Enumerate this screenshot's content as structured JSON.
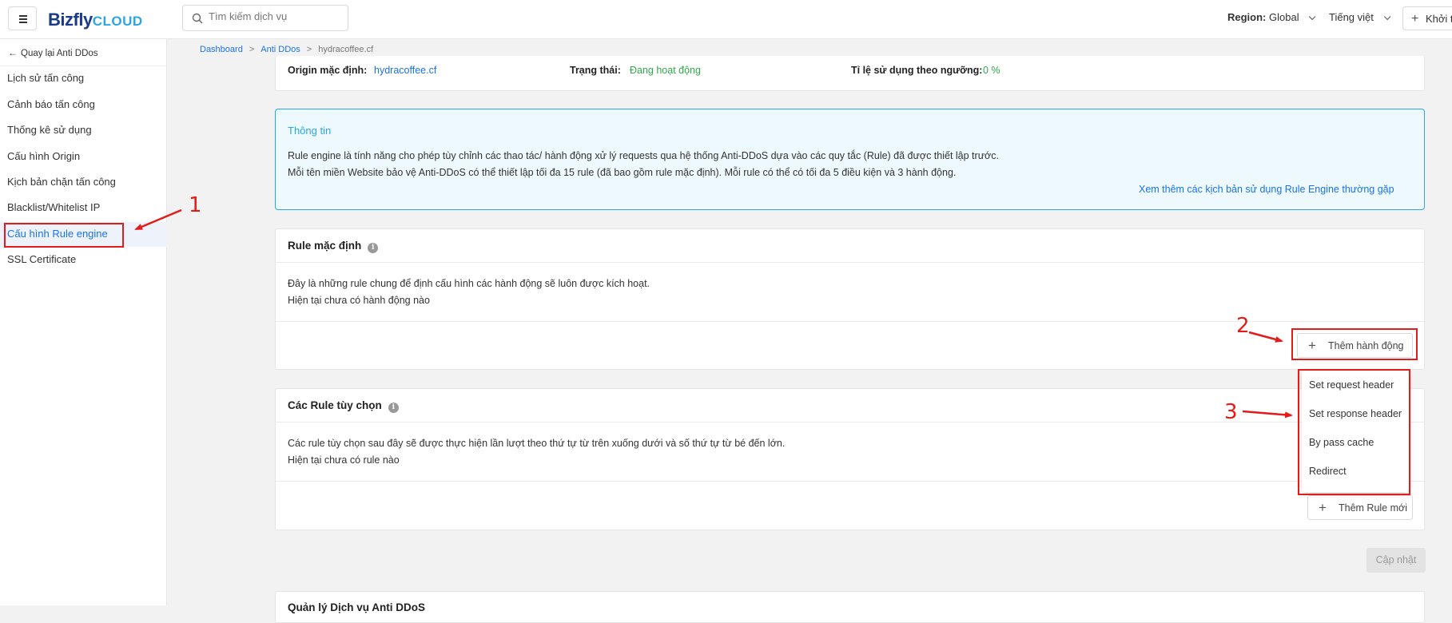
{
  "topbar": {
    "logo_main": "Bizfly",
    "logo_cloud": "CLOUD",
    "search_placeholder": "Tìm kiếm dịch vụ",
    "region_label": "Region:",
    "region_value": "Global",
    "language": "Tiếng việt",
    "init_button": "Khởi tạo"
  },
  "sidebar": {
    "back_label": "Quay lại Anti DDos",
    "items": [
      {
        "label": "Lịch sử tấn công"
      },
      {
        "label": "Cảnh báo tấn công"
      },
      {
        "label": "Thống kê sử dụng"
      },
      {
        "label": "Cấu hình Origin"
      },
      {
        "label": "Kịch bản chặn tấn công"
      },
      {
        "label": "Blacklist/Whitelist IP"
      },
      {
        "label": "Cấu hình Rule engine"
      },
      {
        "label": "SSL Certificate"
      }
    ],
    "active_item": "Cấu hình Rule engine"
  },
  "breadcrumb": {
    "items": [
      "Dashboard",
      "Anti DDos",
      "hydracoffee.cf"
    ],
    "separator": ">"
  },
  "origin": {
    "origin_label": "Origin mặc định:",
    "origin_value": "hydracoffee.cf",
    "status_label": "Trạng thái:",
    "status_value": "Đang hoạt động",
    "usage_label": "Tỉ lệ sử dụng theo ngưỡng:",
    "usage_value": "0 %"
  },
  "info": {
    "title": "Thông tin",
    "line1": "Rule engine là tính năng cho phép tùy chỉnh các thao tác/ hành động xử lý requests qua hệ thống Anti-DDoS dựa vào các quy tắc (Rule) đã được thiết lập trước.",
    "line2": "Mỗi tên miền Website bảo vệ Anti-DDoS có thể thiết lập tối đa 15 rule (đã bao gồm rule mặc định). Mỗi rule có thể có tối đa 5 điều kiện và 3 hành động.",
    "link": "Xem thêm các kịch bản sử dụng Rule Engine thường gặp"
  },
  "default_rule": {
    "title": "Rule mặc định",
    "desc": "Đây là những rule chung để định cấu hình các hành động sẽ luôn được kích hoạt.",
    "empty": "Hiện tại chưa có hành động nào",
    "add_action_button": "Thêm hành động"
  },
  "action_menu": {
    "items": [
      "Set request header",
      "Set response header",
      "By pass cache",
      "Redirect"
    ]
  },
  "custom_rules": {
    "title": "Các Rule tùy chọn",
    "desc": "Các rule tùy chọn sau đây sẽ được thực hiện lần lượt theo thứ tự từ trên xuống dưới và số thứ tự từ bé đến lớn.",
    "empty": "Hiện tại chưa có rule nào",
    "add_rule_button": "Thêm Rule mới"
  },
  "update_button": "Cập nhật",
  "bottom_section_title": "Quản lý Dịch vụ Anti DDoS",
  "annotations": {
    "step1": "1",
    "step2": "2",
    "step3": "3",
    "color": "#e31b1b"
  },
  "colors": {
    "link": "#1a73e8",
    "success": "#2eaa4a",
    "info_border": "#2aa6e8",
    "info_bg": "#eef9fe"
  }
}
